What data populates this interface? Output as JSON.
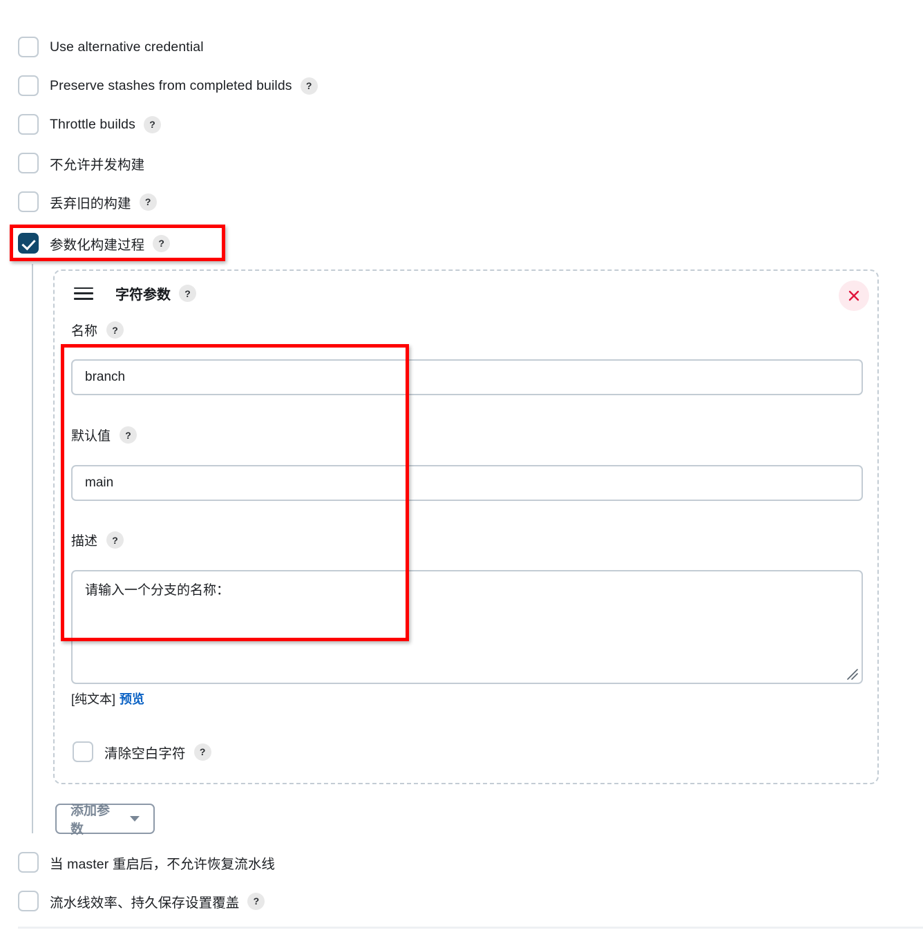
{
  "top_options": [
    {
      "label": "Use alternative credential",
      "checked": false,
      "help": false,
      "help_glyph": "?"
    },
    {
      "label": "Preserve stashes from completed builds",
      "checked": false,
      "help": true,
      "help_glyph": "?"
    },
    {
      "label": "Throttle builds",
      "checked": false,
      "help": true,
      "help_glyph": "?"
    },
    {
      "label": "不允许并发构建",
      "checked": false,
      "help": false,
      "help_glyph": "?"
    },
    {
      "label": "丢弃旧的构建",
      "checked": false,
      "help": true,
      "help_glyph": "?"
    },
    {
      "label": "参数化构建过程",
      "checked": true,
      "help": true,
      "help_glyph": "?"
    }
  ],
  "parameter_card": {
    "menu_icon": "hamburger-icon",
    "title": "字符参数",
    "title_help": "?",
    "close_icon": "close-icon",
    "fields": {
      "name": {
        "label": "名称",
        "help": "?",
        "value": "branch",
        "placeholder": ""
      },
      "default_value": {
        "label": "默认值",
        "help": "?",
        "value": "main",
        "placeholder": ""
      },
      "description": {
        "label": "描述",
        "help": "?",
        "value": "请输入一个分支的名称：",
        "placeholder": ""
      }
    },
    "markup_note": "[纯文本]",
    "preview_link": "预览",
    "trim_checkbox": {
      "label": "清除空白字符",
      "help": "?",
      "checked": false
    }
  },
  "add_parameter_button": {
    "label": "添加参数",
    "caret_icon": "chevron-down-icon"
  },
  "bottom_options": [
    {
      "label": "当 master 重启后，不允许恢复流水线",
      "checked": false,
      "help": false,
      "help_glyph": "?"
    },
    {
      "label": "流水线效率、持久保存设置覆盖",
      "checked": false,
      "help": true,
      "help_glyph": "?"
    }
  ],
  "colors": {
    "checkbox_checked": "#11486b",
    "border": "#c3ccd4",
    "highlight": "#fe0000",
    "link": "#0b62c4",
    "close_bg": "#fdeaee",
    "close_fg": "#e0143c"
  }
}
